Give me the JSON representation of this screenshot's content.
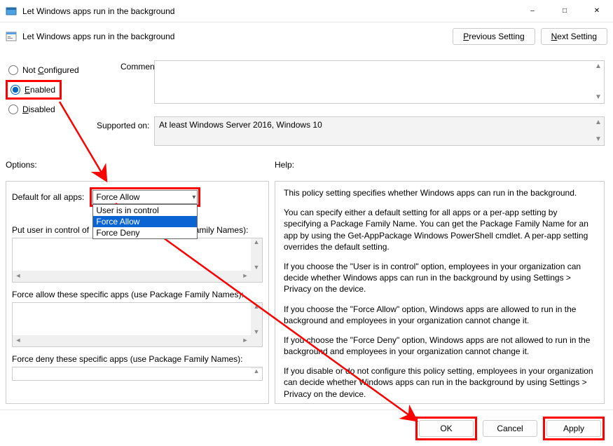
{
  "window": {
    "title": "Let Windows apps run in the background",
    "subtitle": "Let Windows apps run in the background"
  },
  "nav": {
    "previous": "Previous Setting",
    "next": "Next Setting"
  },
  "state": {
    "not_configured": "Not Configured",
    "enabled": "Enabled",
    "disabled": "Disabled",
    "selected": "enabled"
  },
  "labels": {
    "comment": "Comment:",
    "supported_on": "Supported on:",
    "options": "Options:",
    "help": "Help:"
  },
  "supported_text": "At least Windows Server 2016, Windows 10",
  "options": {
    "default_label": "Default for all apps:",
    "combo_value": "Force Allow",
    "combo_items": [
      "User is in control",
      "Force Allow",
      "Force Deny"
    ],
    "list1_label": "Put user in control of these specific apps (use Package Family Names):",
    "list2_label": "Force allow these specific apps (use Package Family Names):",
    "list3_label": "Force deny these specific apps (use Package Family Names):"
  },
  "help_text": {
    "p1": "This policy setting specifies whether Windows apps can run in the background.",
    "p2": "You can specify either a default setting for all apps or a per-app setting by specifying a Package Family Name. You can get the Package Family Name for an app by using the Get-AppPackage Windows PowerShell cmdlet. A per-app setting overrides the default setting.",
    "p3": "If you choose the \"User is in control\" option, employees in your organization can decide whether Windows apps can run in the background by using Settings > Privacy on the device.",
    "p4": "If you choose the \"Force Allow\" option, Windows apps are allowed to run in the background and employees in your organization cannot change it.",
    "p5": "If you choose the \"Force Deny\" option, Windows apps are not allowed to run in the background and employees in your organization cannot change it.",
    "p6": "If you disable or do not configure this policy setting, employees in your organization can decide whether Windows apps can run in the background by using Settings > Privacy on the device."
  },
  "buttons": {
    "ok": "OK",
    "cancel": "Cancel",
    "apply": "Apply"
  }
}
